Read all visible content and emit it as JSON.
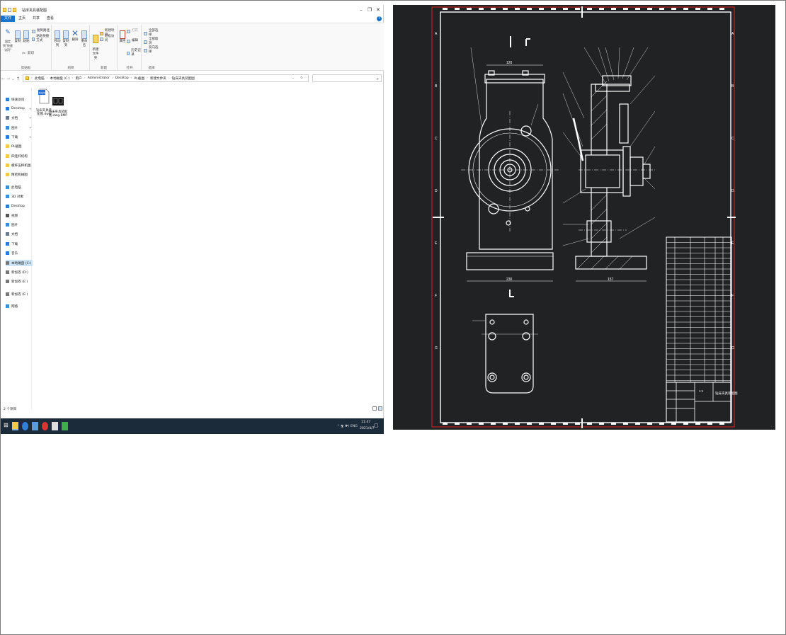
{
  "explorer": {
    "window_title": "钻床夹具装配图",
    "ribbon_tabs": [
      "文件",
      "主页",
      "共享",
      "查看"
    ],
    "help": "?",
    "ribbon": {
      "groups": [
        "剪贴板",
        "组织",
        "新建",
        "打开",
        "选择"
      ],
      "pin_quick": "固定到\"快速访问\"",
      "copy": "复制",
      "paste": "粘贴",
      "cut": "剪切",
      "copy_path": "复制路径",
      "paste_shortcut": "粘贴快捷方式",
      "move_to": "移动到",
      "copy_to": "复制到",
      "delete": "删除",
      "rename": "重命名",
      "new_folder": "新建\n文件夹",
      "new_item": "新建项目",
      "easy_access": "轻松访问",
      "properties": "属性",
      "open": "打开",
      "edit": "编辑",
      "history": "历史记录",
      "select_all": "全部选择",
      "select_none": "全部取消",
      "invert": "反向选择"
    },
    "address_crumbs": [
      "此电脑",
      "本地磁盘 (C:)",
      "用户",
      "Administrator",
      "Desktop",
      "PL截图",
      "新建文件夹",
      "钻床夹具装配图"
    ],
    "nav": [
      {
        "label": "快速访问",
        "icon": "star-icon",
        "color": "#2f7bd0"
      },
      {
        "label": "Desktop",
        "icon": "desktop-icon",
        "color": "#2f7bd0",
        "pinned": true
      },
      {
        "label": "文档",
        "icon": "documents-icon",
        "color": "#6a7a8c",
        "pinned": true
      },
      {
        "label": "图片",
        "icon": "pictures-icon",
        "color": "#3b8ad8",
        "pinned": true
      },
      {
        "label": "下载",
        "icon": "download-icon",
        "color": "#2f7bd0",
        "pinned": true
      },
      {
        "label": "PL截图",
        "icon": "folder-icon",
        "color": "#f2c94c"
      },
      {
        "label": "四连杆机构",
        "icon": "folder-icon",
        "color": "#f2c94c"
      },
      {
        "label": "螺杆压榨机图",
        "icon": "folder-icon",
        "color": "#f2c94c"
      },
      {
        "label": "精密机械图",
        "icon": "folder-icon",
        "color": "#f2c94c"
      },
      {
        "label": "此电脑",
        "icon": "computer-icon",
        "color": "#3a8fd9"
      },
      {
        "label": "3D 对象",
        "icon": "3d-objects-icon",
        "color": "#3a8fd9"
      },
      {
        "label": "Desktop",
        "icon": "desktop-icon",
        "color": "#2f7bd0"
      },
      {
        "label": "视频",
        "icon": "videos-icon",
        "color": "#555555"
      },
      {
        "label": "图片",
        "icon": "pictures-icon",
        "color": "#3b8ad8"
      },
      {
        "label": "文档",
        "icon": "documents-icon",
        "color": "#6a7a8c"
      },
      {
        "label": "下载",
        "icon": "download-icon",
        "color": "#2f7bd0"
      },
      {
        "label": "音乐",
        "icon": "music-icon",
        "color": "#2f7bd0"
      },
      {
        "label": "本地磁盘 (C:)",
        "icon": "drive-icon",
        "color": "#777777",
        "selected": true
      },
      {
        "label": "新加卷 (D:)",
        "icon": "drive-icon",
        "color": "#777777"
      },
      {
        "label": "新加卷 (E:)",
        "icon": "drive-icon",
        "color": "#777777"
      },
      {
        "label": "新加卷 (E:)",
        "icon": "drive-icon",
        "color": "#777777"
      },
      {
        "label": "网络",
        "icon": "network-icon",
        "color": "#3a8fd9"
      }
    ],
    "files": [
      {
        "name": "钻床夹具装配图.dwg",
        "icon": "dwg-file-icon"
      },
      {
        "name": "钻床夹具装配图.dwg.BMP",
        "icon": "bmp-file-icon"
      }
    ],
    "status": "2 个项目",
    "taskbar": {
      "tray": "^ 🖫 🕪) ENG",
      "time": "11:47",
      "date": "2021/4/7"
    }
  },
  "drawing": {
    "title_block_text": "钻床夹具装配图",
    "scale_text": "1:1",
    "dim_width_main": "230",
    "dim_width_side": "157",
    "dim_top": "120",
    "border_letters_left": [
      "A",
      "B",
      "C",
      "D",
      "E",
      "F",
      "G"
    ],
    "border_color": "#e02020",
    "line_color": "#ffffff",
    "bg_color": "#212224"
  }
}
